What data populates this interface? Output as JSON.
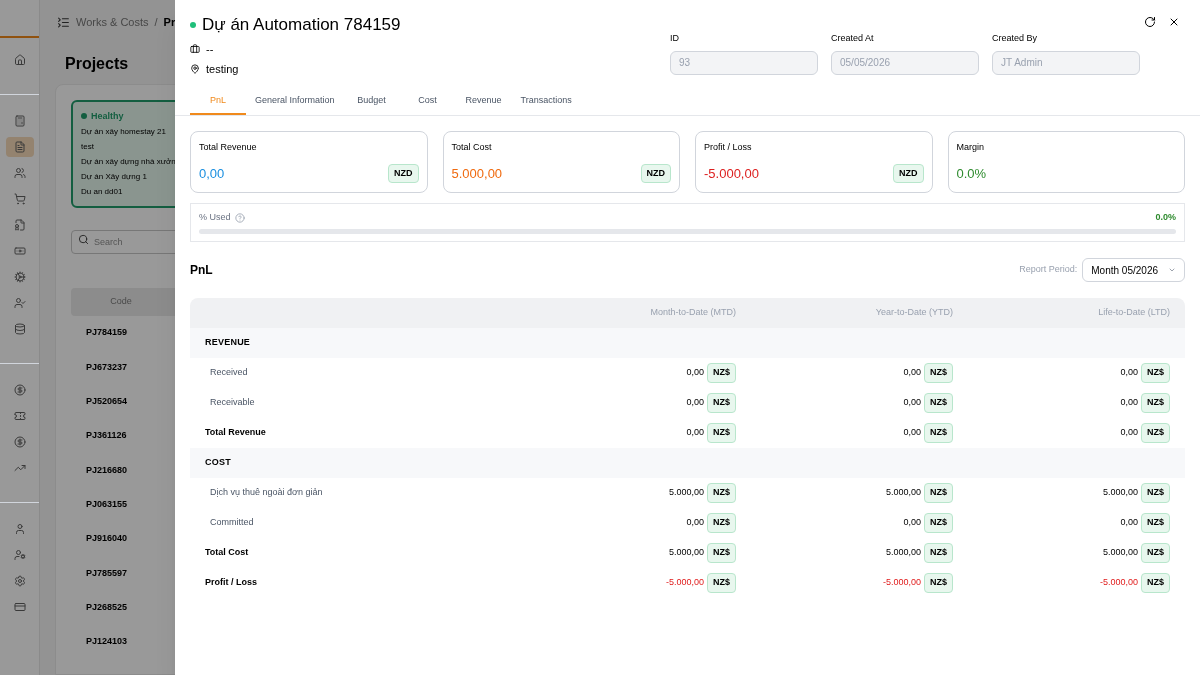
{
  "background": {
    "breadcrumb": [
      "Works & Costs",
      "Pr"
    ],
    "breadcrumb_separator": "/",
    "sidebar": {
      "groups": [
        [
          {
            "selected": false
          }
        ],
        [
          {
            "selected": false
          },
          {
            "selected": true
          },
          {
            "selected": false
          },
          {
            "selected": false
          },
          {
            "selected": false
          },
          {
            "selected": false
          },
          {
            "selected": false
          },
          {
            "selected": false
          },
          {
            "selected": false
          }
        ],
        [
          {
            "selected": false
          },
          {
            "selected": false
          },
          {
            "selected": false
          },
          {
            "selected": false
          }
        ],
        [
          {
            "selected": false
          },
          {
            "selected": false
          },
          {
            "selected": false
          },
          {
            "selected": false
          }
        ]
      ]
    },
    "title": "Projects",
    "status_card": {
      "label": "Healthy",
      "color": "#135e40",
      "projects": [
        "Dự án xây homestay 21",
        "test",
        "Dự án xây dựng nhà xưởn",
        "Dự án Xây dựng 1",
        "Du an dd01"
      ]
    },
    "search": {
      "placeholder": "Search"
    },
    "table": {
      "columns": [
        "Code"
      ],
      "rows": [
        "PJ784159",
        "PJ673237",
        "PJ520654",
        "PJ361126",
        "PJ216680",
        "PJ063155",
        "PJ916040",
        "PJ785597",
        "PJ268525",
        "PJ124103"
      ]
    }
  },
  "drawer": {
    "title": "Dự án Automation 784159",
    "status": {
      "color": "#1fbf7a"
    },
    "category": "--",
    "location": "testing",
    "fields": [
      {
        "label": "ID",
        "value": "93",
        "disabled": true
      },
      {
        "label": "Created At",
        "value": "05/05/2026",
        "disabled": true
      },
      {
        "label": "Created By",
        "value": "JT Admin",
        "disabled": true
      }
    ],
    "tabs": [
      {
        "label": "PnL",
        "selected": true
      },
      {
        "label": "General Information",
        "selected": false
      },
      {
        "label": "Budget",
        "selected": false
      },
      {
        "label": "Cost",
        "selected": false
      },
      {
        "label": "Revenue",
        "selected": false
      },
      {
        "label": "Transactions",
        "selected": false
      }
    ],
    "summary_cards": [
      {
        "label": "Total Revenue",
        "value": "0,00",
        "color": "#1a8fe0",
        "currency": "NZD"
      },
      {
        "label": "Total Cost",
        "value": "5.000,00",
        "color": "#f06a0f",
        "currency": "NZD"
      },
      {
        "label": "Profit / Loss",
        "value": "-5.000,00",
        "color": "#dd1f1f",
        "currency": "NZD"
      },
      {
        "label": "Margin",
        "value": "0.0%",
        "color": "#2e8b2e"
      }
    ],
    "usage": {
      "label": "% Used",
      "reading": "0.0%",
      "level": 0
    },
    "pnl": {
      "title": "PnL",
      "period_label": "Report Period:",
      "period": "Month 05/2026",
      "columns": [
        "Month-to-Date (MTD)",
        "Year-to-Date (YTD)",
        "Life-to-Date (LTD)"
      ],
      "rows": [
        {
          "kind": "section",
          "label": "REVENUE"
        },
        {
          "kind": "item",
          "label": "Received",
          "negative": false,
          "values": [
            {
              "amount": "0,00",
              "currency": "NZ$"
            },
            {
              "amount": "0,00",
              "currency": "NZ$"
            },
            {
              "amount": "0,00",
              "currency": "NZ$"
            }
          ]
        },
        {
          "kind": "item",
          "label": "Receivable",
          "negative": false,
          "values": [
            {
              "amount": "0,00",
              "currency": "NZ$"
            },
            {
              "amount": "0,00",
              "currency": "NZ$"
            },
            {
              "amount": "0,00",
              "currency": "NZ$"
            }
          ]
        },
        {
          "kind": "total",
          "label": "Total Revenue",
          "negative": false,
          "values": [
            {
              "amount": "0,00",
              "currency": "NZ$"
            },
            {
              "amount": "0,00",
              "currency": "NZ$"
            },
            {
              "amount": "0,00",
              "currency": "NZ$"
            }
          ]
        },
        {
          "kind": "section",
          "label": "COST"
        },
        {
          "kind": "item",
          "label": "Dịch vụ thuê ngoài đơn giản",
          "negative": false,
          "values": [
            {
              "amount": "5.000,00",
              "currency": "NZ$"
            },
            {
              "amount": "5.000,00",
              "currency": "NZ$"
            },
            {
              "amount": "5.000,00",
              "currency": "NZ$"
            }
          ]
        },
        {
          "kind": "item",
          "label": "Committed",
          "negative": false,
          "values": [
            {
              "amount": "0,00",
              "currency": "NZ$"
            },
            {
              "amount": "0,00",
              "currency": "NZ$"
            },
            {
              "amount": "0,00",
              "currency": "NZ$"
            }
          ]
        },
        {
          "kind": "total",
          "label": "Total Cost",
          "negative": false,
          "values": [
            {
              "amount": "5.000,00",
              "currency": "NZ$"
            },
            {
              "amount": "5.000,00",
              "currency": "NZ$"
            },
            {
              "amount": "5.000,00",
              "currency": "NZ$"
            }
          ]
        },
        {
          "kind": "total",
          "label": "Profit / Loss",
          "negative": true,
          "values": [
            {
              "amount": "-5.000,00",
              "currency": "NZ$"
            },
            {
              "amount": "-5.000,00",
              "currency": "NZ$"
            },
            {
              "amount": "-5.000,00",
              "currency": "NZ$"
            }
          ]
        }
      ]
    }
  }
}
